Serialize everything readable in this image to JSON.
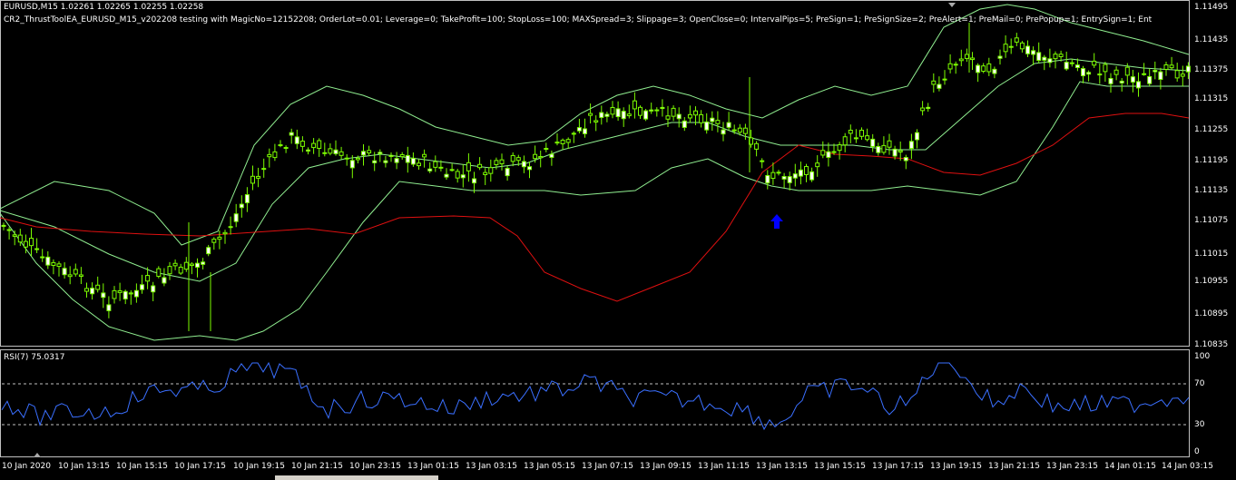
{
  "header": {
    "symbol_line": "EURUSD,M15  1.02261 1.02265 1.02255 1.02258",
    "ea_info": "CR2_ThrustToolEA_EURUSD_M15_v202208 testing with MagicNo=12152208; OrderLot=0.01; Leverage=0; TakeProfit=100; StopLoss=100; MAXSpread=3; Slippage=3; OpenClose=0; IntervalPips=5; PreSign=1; PreSignSize=2; PreAlert=1; PreMail=0; PrePopup=1; EntrySign=1; Ent"
  },
  "indicator": {
    "rsi_label": "RSI(7) 75.0317"
  },
  "price_axis": [
    "1.11495",
    "1.11435",
    "1.11375",
    "1.11315",
    "1.11255",
    "1.11195",
    "1.11135",
    "1.11075",
    "1.11015",
    "1.10955",
    "1.10895",
    "1.10835"
  ],
  "rsi_axis": [
    "100",
    "70",
    "30",
    "0"
  ],
  "time_axis": [
    "10 Jan 2020",
    "10 Jan 13:15",
    "10 Jan 15:15",
    "10 Jan 17:15",
    "10 Jan 19:15",
    "10 Jan 21:15",
    "10 Jan 23:15",
    "13 Jan 01:15",
    "13 Jan 03:15",
    "13 Jan 05:15",
    "13 Jan 07:15",
    "13 Jan 09:15",
    "13 Jan 11:15",
    "13 Jan 13:15",
    "13 Jan 15:15",
    "13 Jan 17:15",
    "13 Jan 19:15",
    "13 Jan 21:15",
    "13 Jan 23:15",
    "14 Jan 01:15",
    "14 Jan 03:15"
  ],
  "colors": {
    "background": "#000000",
    "bull_candle": "#ffffff",
    "bear_candle": "#7cfc00",
    "wick": "#7cfc00",
    "bands": "#90ee90",
    "red_line": "#e01010",
    "rsi_line": "#3a6fff",
    "levels": "#c0c0c0",
    "signal_arrow": "#0000ff"
  },
  "icons": {
    "signal": "up-arrow-icon"
  }
}
